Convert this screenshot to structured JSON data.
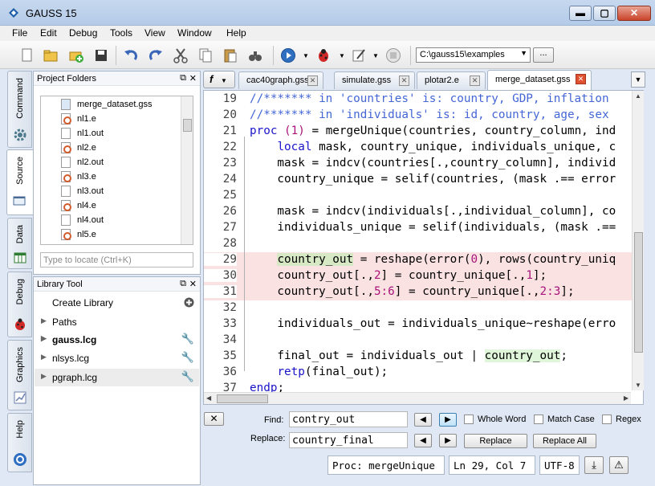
{
  "window": {
    "title": "GAUSS 15",
    "min": "▬",
    "max": "▢",
    "close": "✕"
  },
  "menu": [
    "File",
    "Edit",
    "Debug",
    "Tools",
    "View",
    "Window",
    "Help"
  ],
  "toolbar": {
    "directory": "C:\\gauss15\\examples",
    "browse_label": "...",
    "icons": [
      "new-file-icon",
      "open-folder-icon",
      "new-project-icon",
      "save-icon",
      "undo-icon",
      "redo-icon",
      "cut-icon",
      "copy-icon",
      "paste-icon",
      "binoculars-icon",
      "run-icon",
      "debug-icon",
      "edit-icon",
      "stop-icon"
    ]
  },
  "vtabs": [
    "Command",
    "Source",
    "Data",
    "Debug",
    "Graphics",
    "Help"
  ],
  "project_folders": {
    "title": "Project Folders",
    "files": [
      {
        "name": "merge_dataset.gss",
        "type": "gss"
      },
      {
        "name": "nl1.e",
        "type": "e"
      },
      {
        "name": "nl1.out",
        "type": "out"
      },
      {
        "name": "nl2.e",
        "type": "e"
      },
      {
        "name": "nl2.out",
        "type": "out"
      },
      {
        "name": "nl3.e",
        "type": "e"
      },
      {
        "name": "nl3.out",
        "type": "out"
      },
      {
        "name": "nl4.e",
        "type": "e"
      },
      {
        "name": "nl4.out",
        "type": "out"
      },
      {
        "name": "nl5.e",
        "type": "e"
      }
    ],
    "locate_placeholder": "Type to locate (Ctrl+K)"
  },
  "library_tool": {
    "title": "Library Tool",
    "create_label": "Create Library",
    "items": [
      {
        "name": "Paths",
        "bold": false,
        "wrench": false
      },
      {
        "name": "gauss.lcg",
        "bold": true,
        "wrench": true
      },
      {
        "name": "nlsys.lcg",
        "bold": false,
        "wrench": true
      },
      {
        "name": "pgraph.lcg",
        "bold": false,
        "wrench": true
      }
    ]
  },
  "editor": {
    "fn_label": "f",
    "tabs": [
      {
        "label": "cac40graph.gss",
        "active": false
      },
      {
        "label": "simulate.gss",
        "active": false
      },
      {
        "label": "plotar2.e",
        "active": false
      },
      {
        "label": "merge_dataset.gss",
        "active": true
      }
    ],
    "lines": [
      {
        "n": "19",
        "segs": [
          [
            "comment",
            "//******* in 'countries' is: country, GDP, inflation"
          ]
        ]
      },
      {
        "n": "20",
        "segs": [
          [
            "comment",
            "//******* in 'individuals' is: id, country, age, sex"
          ]
        ]
      },
      {
        "n": "21",
        "segs": [
          [
            "kw",
            "proc"
          ],
          [
            "",
            " "
          ],
          [
            "num",
            "(1)"
          ],
          [
            "",
            " = mergeUnique(countries, country_column, ind"
          ]
        ]
      },
      {
        "n": "22",
        "segs": [
          [
            "",
            "    "
          ],
          [
            "kw",
            "local"
          ],
          [
            "",
            " mask, country_unique, individuals_unique, c"
          ]
        ]
      },
      {
        "n": "23",
        "segs": [
          [
            "",
            "    mask = indcv(countries[.,country_column], individ"
          ]
        ]
      },
      {
        "n": "24",
        "segs": [
          [
            "",
            "    country_unique = selif(countries, (mask .== error"
          ]
        ]
      },
      {
        "n": "25",
        "segs": [
          [
            "",
            ""
          ]
        ]
      },
      {
        "n": "26",
        "segs": [
          [
            "",
            "    mask = indcv(individuals[.,individual_column], co"
          ]
        ]
      },
      {
        "n": "27",
        "segs": [
          [
            "",
            "    individuals_unique = selif(individuals, (mask .=="
          ]
        ]
      },
      {
        "n": "28",
        "segs": [
          [
            "",
            ""
          ]
        ]
      },
      {
        "n": "29",
        "hl": true,
        "segs": [
          [
            "",
            "    "
          ],
          [
            "mark-sel",
            "country_out"
          ],
          [
            "",
            " = reshape(error("
          ],
          [
            "num",
            "0"
          ],
          [
            "",
            "), rows(country_uniq"
          ]
        ]
      },
      {
        "n": "30",
        "hl": true,
        "segs": [
          [
            "",
            "    country_out[.,"
          ],
          [
            "num",
            "2"
          ],
          [
            "",
            "] = country_unique[.,"
          ],
          [
            "num",
            "1"
          ],
          [
            "",
            "];"
          ]
        ]
      },
      {
        "n": "31",
        "hl": true,
        "segs": [
          [
            "",
            "    country_out[.,"
          ],
          [
            "num",
            "5:6"
          ],
          [
            "",
            "] = country_unique[.,"
          ],
          [
            "num",
            "2:3"
          ],
          [
            "",
            "];"
          ]
        ]
      },
      {
        "n": "32",
        "segs": [
          [
            "",
            ""
          ]
        ]
      },
      {
        "n": "33",
        "segs": [
          [
            "",
            "    individuals_out = individuals_unique~reshape(erro"
          ]
        ]
      },
      {
        "n": "34",
        "segs": [
          [
            "",
            ""
          ]
        ]
      },
      {
        "n": "35",
        "segs": [
          [
            "",
            "    final_out = individuals_out | "
          ],
          [
            "mark-green",
            "country_out"
          ],
          [
            "",
            ";"
          ]
        ]
      },
      {
        "n": "36",
        "segs": [
          [
            "",
            "    "
          ],
          [
            "kw",
            "retp"
          ],
          [
            "",
            "(final_out);"
          ]
        ]
      },
      {
        "n": "37",
        "segs": [
          [
            "kw",
            "endp"
          ],
          [
            "",
            ";"
          ]
        ]
      }
    ]
  },
  "find": {
    "find_label": "Find:",
    "find_value": "contry_out",
    "replace_label": "Replace:",
    "replace_value": "country_final",
    "whole_word": "Whole Word",
    "match_case": "Match Case",
    "regex": "Regex",
    "replace_btn": "Replace",
    "replace_all_btn": "Replace All"
  },
  "status": {
    "proc": "Proc: mergeUnique",
    "position": "Ln 29, Col 7",
    "encoding": "UTF-8"
  }
}
